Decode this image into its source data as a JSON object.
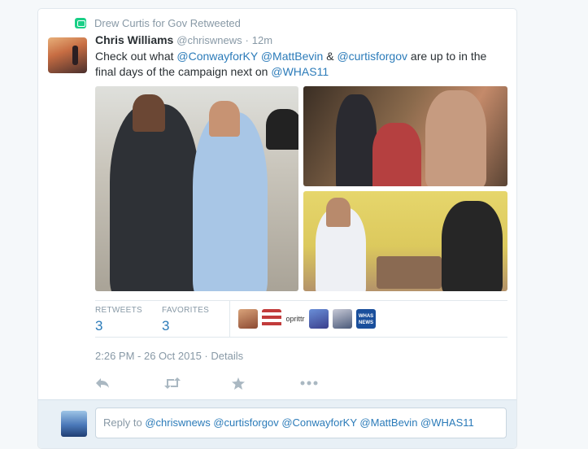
{
  "context": {
    "label": "Drew Curtis for Gov Retweeted"
  },
  "tweet": {
    "author_name": "Chris Williams",
    "author_handle": "@chriswnews",
    "separator": "·",
    "time_ago": "12m",
    "text_parts": [
      {
        "text": "Check out what ",
        "type": "text"
      },
      {
        "text": "@ConwayforKY",
        "type": "mention"
      },
      {
        "text": " ",
        "type": "text"
      },
      {
        "text": "@MattBevin",
        "type": "mention"
      },
      {
        "text": " & ",
        "type": "text"
      },
      {
        "text": "@curtisforgov",
        "type": "mention"
      },
      {
        "text": " are up to in the final days of the campaign next on ",
        "type": "text"
      },
      {
        "text": "@WHAS11",
        "type": "mention"
      }
    ]
  },
  "stats": {
    "retweets_label": "RETWEETS",
    "retweets_count": "3",
    "favorites_label": "FAVORITES",
    "favorites_count": "3",
    "avatar_labels": [
      "",
      "",
      "oprittr",
      "",
      "",
      "WHAS NEWS"
    ]
  },
  "timestamp": {
    "datetime": "2:26 PM - 26 Oct 2015",
    "separator": "·",
    "details": "Details"
  },
  "actions": [
    "reply-icon",
    "retweet-icon",
    "favorite-icon",
    "more-icon"
  ],
  "reply": {
    "prefix": "Reply to ",
    "mentions": [
      "@chriswnews",
      "@curtisforgov",
      "@ConwayforKY",
      "@MattBevin",
      "@WHAS11"
    ]
  },
  "colors": {
    "link": "#2b7bb9",
    "muted": "#8899a6",
    "retweet_green": "#19cf86"
  }
}
